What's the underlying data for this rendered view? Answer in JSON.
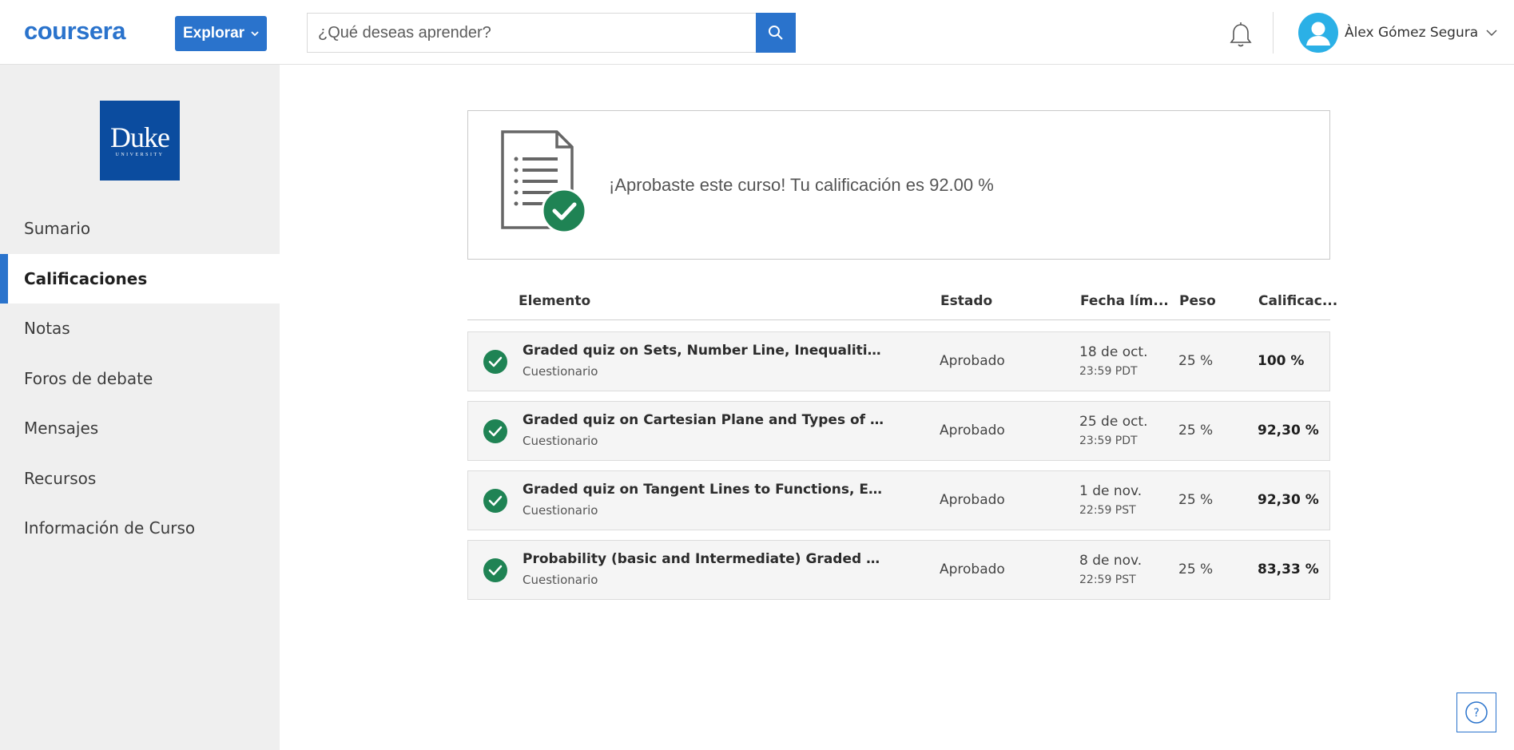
{
  "header": {
    "logo_text": "coursera",
    "explore_label": "Explorar",
    "search": {
      "placeholder": "¿Qué deseas aprender?",
      "value": ""
    },
    "user_name": "Àlex Gómez Segura"
  },
  "colors": {
    "brand_blue": "#2a73cc",
    "duke_blue": "#0b4c9f",
    "success_green": "#1f8354"
  },
  "sidebar": {
    "university_logo": {
      "name": "Duke",
      "sub": "UNIVERSITY"
    },
    "items": [
      {
        "label": "Sumario"
      },
      {
        "label": "Calificaciones",
        "active": true
      },
      {
        "label": "Notas"
      },
      {
        "label": "Foros de debate"
      },
      {
        "label": "Mensajes"
      },
      {
        "label": "Recursos"
      },
      {
        "label": "Información de Curso"
      }
    ]
  },
  "banner": {
    "message": "¡Aprobaste este curso! Tu calificación es 92.00 %"
  },
  "table": {
    "headers": {
      "item": "Elemento",
      "status": "Estado",
      "due": "Fecha lím...",
      "weight": "Peso",
      "grade": "Calificac..."
    },
    "rows": [
      {
        "title": "Graded quiz on Sets, Number Line, Inequalities, Si...",
        "type": "Cuestionario",
        "status": "Aprobado",
        "date": "18 de oct.",
        "time": "23:59 PDT",
        "weight": "25 %",
        "grade": "100 %"
      },
      {
        "title": "Graded quiz on Cartesian Plane and Types of Funct...",
        "type": "Cuestionario",
        "status": "Aprobado",
        "date": "25 de oct.",
        "time": "23:59 PDT",
        "weight": "25 %",
        "grade": "92,30 %"
      },
      {
        "title": "Graded quiz on Tangent Lines to Functions, Expone...",
        "type": "Cuestionario",
        "status": "Aprobado",
        "date": "1 de nov.",
        "time": "22:59 PST",
        "weight": "25 %",
        "grade": "92,30 %"
      },
      {
        "title": "Probability (basic and Intermediate) Graded Quiz",
        "type": "Cuestionario",
        "status": "Aprobado",
        "date": "8 de nov.",
        "time": "22:59 PST",
        "weight": "25 %",
        "grade": "83,33 %"
      }
    ]
  },
  "help": {
    "icon": "question-icon"
  }
}
